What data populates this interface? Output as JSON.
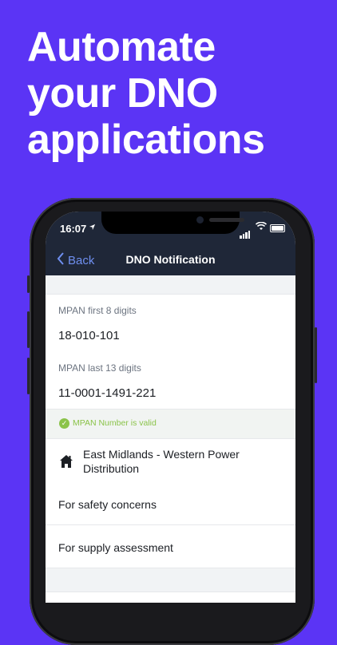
{
  "headline": [
    "Automate",
    "your DNO",
    "applications"
  ],
  "status_bar": {
    "time": "16:07",
    "location_icon": "location-arrow-icon"
  },
  "navbar": {
    "back_label": "Back",
    "title": "DNO Notification"
  },
  "form": {
    "mpan_first": {
      "label": "MPAN first 8 digits",
      "value": "18-010-101"
    },
    "mpan_last": {
      "label": "MPAN last 13 digits",
      "value": "11-0001-1491-221"
    },
    "validation": {
      "text": "MPAN Number is valid",
      "color": "#8bc34a"
    },
    "dno_line1": "East Midlands - Western Power",
    "dno_line2": "Distribution",
    "options": [
      "For safety concerns",
      "For supply assessment"
    ]
  },
  "colors": {
    "background": "#5b34f5",
    "navbar": "#1f2738",
    "link": "#6f8ff0"
  }
}
